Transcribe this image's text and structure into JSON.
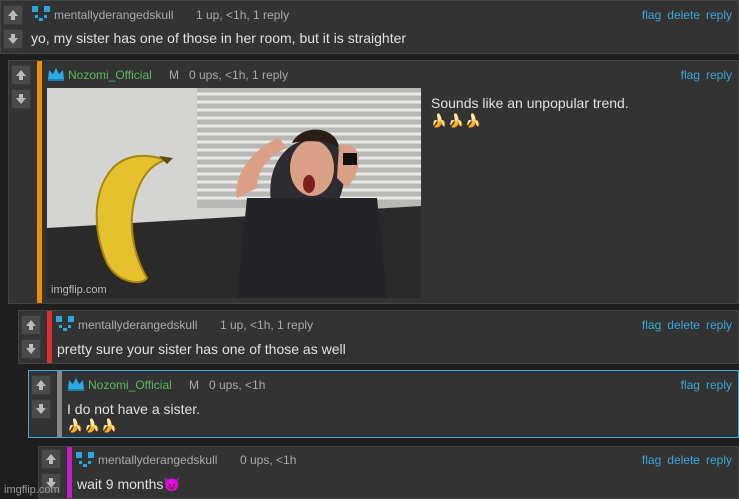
{
  "comments": [
    {
      "username": "mentallyderangedskull",
      "meta": "1 up, <1h, 1 reply",
      "actions": [
        "flag",
        "delete",
        "reply"
      ],
      "text": "yo, my sister has one of those in her room, but it is straighter"
    },
    {
      "username": "Nozomi_Official",
      "badge": "M",
      "meta": "0 ups, <1h, 1 reply",
      "actions": [
        "flag",
        "reply"
      ],
      "text": "Sounds like an unpopular trend.",
      "bananas": "🍌🍌🍌",
      "image_watermark": "imgflip.com"
    },
    {
      "username": "mentallyderangedskull",
      "meta": "1 up, <1h, 1 reply",
      "actions": [
        "flag",
        "delete",
        "reply"
      ],
      "text": "pretty sure your sister has one of those as well"
    },
    {
      "username": "Nozomi_Official",
      "badge": "M",
      "meta": "0 ups, <1h",
      "actions": [
        "flag",
        "reply"
      ],
      "text": "I do not have a sister.",
      "bananas": "🍌🍌🍌"
    },
    {
      "username": "mentallyderangedskull",
      "meta": "0 ups, <1h",
      "actions": [
        "flag",
        "delete",
        "reply"
      ],
      "text": "wait 9 months😈"
    }
  ],
  "colors": {
    "skull_user": "#aaaaaa",
    "nozomi_user": "#5cb85c",
    "bar_orange": "#f08c00",
    "bar_red": "#e03030",
    "bar_gray": "#888888",
    "bar_magenta": "#c020c0",
    "link": "#3aa8d8"
  },
  "footer": {
    "watermark": "imgflip.com"
  }
}
